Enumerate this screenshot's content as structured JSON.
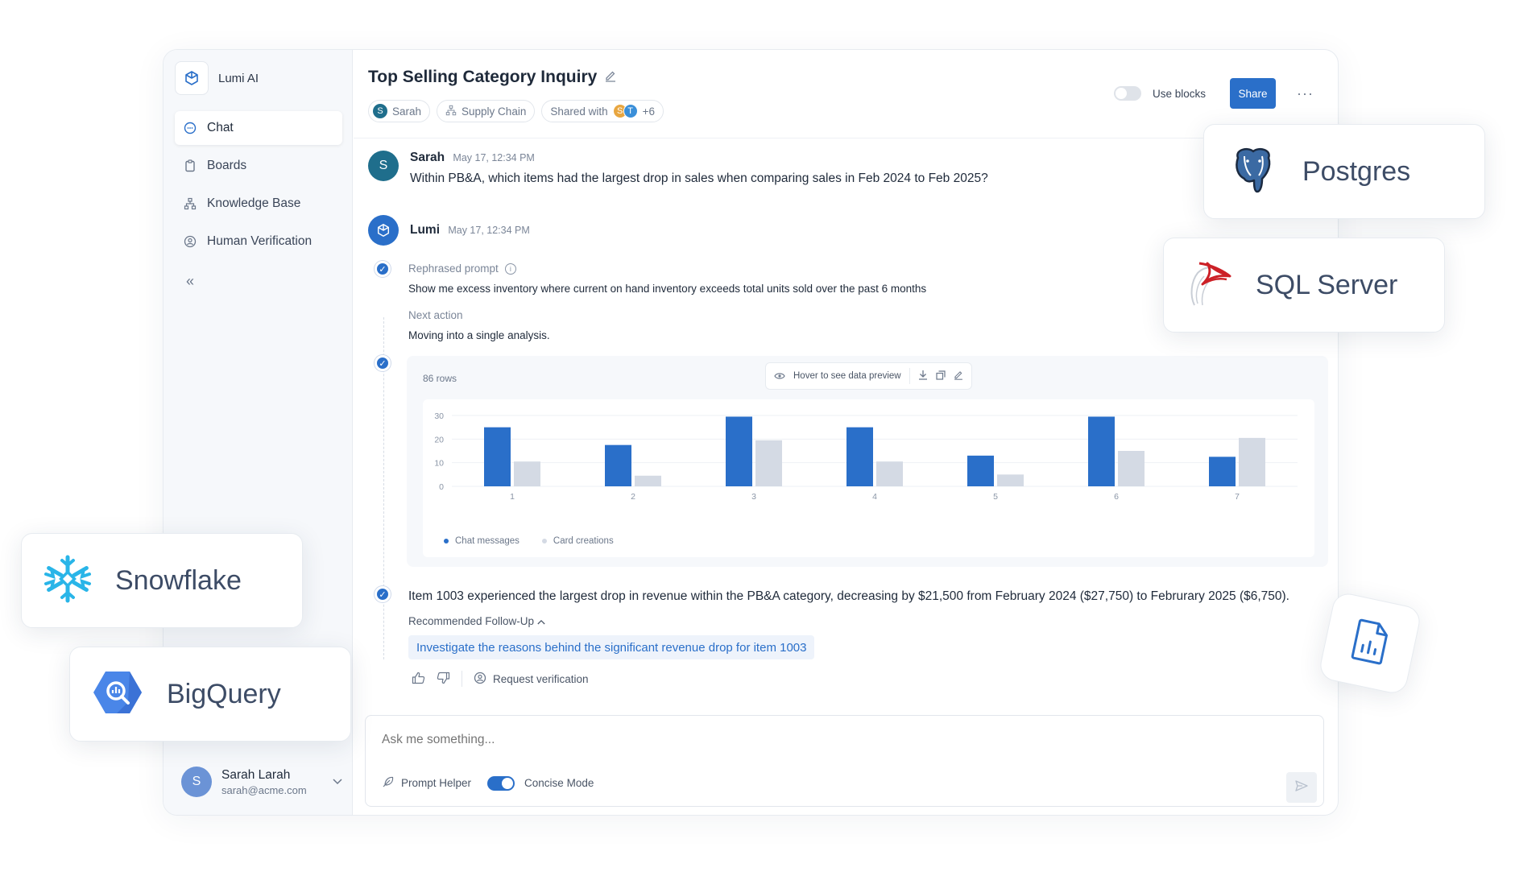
{
  "sidebar": {
    "brand": "Lumi AI",
    "items": [
      {
        "label": "Chat",
        "icon": "chat-icon",
        "active": true
      },
      {
        "label": "Boards",
        "icon": "clipboard-icon"
      },
      {
        "label": "Knowledge Base",
        "icon": "hierarchy-icon"
      },
      {
        "label": "Human Verification",
        "icon": "verification-icon"
      }
    ],
    "collapse_glyph": "«",
    "user": {
      "initial": "S",
      "name": "Sarah Larah",
      "email": "sarah@acme.com"
    }
  },
  "header": {
    "title": "Top Selling Category Inquiry",
    "chips": {
      "owner": {
        "initial": "S",
        "label": "Sarah"
      },
      "team": "Supply Chain",
      "shared": {
        "label": "Shared with",
        "initials": [
          "S",
          "T"
        ],
        "more": "+6"
      }
    },
    "use_blocks_label": "Use blocks",
    "share_label": "Share",
    "more_glyph": "···"
  },
  "messages": {
    "user": {
      "initial": "S",
      "name": "Sarah",
      "time": "May 17, 12:34 PM",
      "text": "Within PB&A, which items had the largest drop in sales when comparing sales in Feb 2024 to Feb 2025?"
    },
    "assistant": {
      "name": "Lumi",
      "time": "May 17, 12:34 PM"
    }
  },
  "steps": {
    "rephrased_label": "Rephrased prompt",
    "rephrased_text": "Show me excess inventory where current on hand inventory exceeds total units sold over the past 6 months",
    "next_label": "Next action",
    "next_text": "Moving into a single analysis."
  },
  "chart_toolbar": {
    "rows": "86 rows",
    "hover": "Hover to see data preview"
  },
  "chart_data": {
    "type": "bar",
    "categories": [
      "1",
      "2",
      "3",
      "4",
      "5",
      "6",
      "7"
    ],
    "series": [
      {
        "name": "Chat messages",
        "values": [
          25,
          17.5,
          29.5,
          25,
          13,
          29.5,
          12.5
        ],
        "color": "#2a6fc9"
      },
      {
        "name": "Card creations",
        "values": [
          10.5,
          4.5,
          19.5,
          10.5,
          5,
          15,
          20.5
        ],
        "color": "#d4dae4"
      }
    ],
    "yticks": [
      0,
      10,
      20,
      30
    ],
    "ylim": [
      0,
      30
    ]
  },
  "answer": {
    "text": "Item 1003 experienced the largest drop in revenue within the PB&A category, decreasing by $21,500 from February 2024 ($27,750) to Februrary 2025 ($6,750).",
    "followup_label": "Recommended Follow-Up",
    "followup_item": "Investigate the reasons behind the significant revenue drop for item 1003",
    "request_verification": "Request verification"
  },
  "input": {
    "placeholder": "Ask me something...",
    "prompt_helper": "Prompt Helper",
    "concise_mode": "Concise Mode"
  },
  "integrations": {
    "postgres": "Postgres",
    "sqlserver": "SQL Server",
    "snowflake": "Snowflake",
    "bigquery": "BigQuery"
  },
  "colors": {
    "accent": "#2a6fc9",
    "secondary": "#d4dae4",
    "teal_avatar": "#1f6e8c"
  }
}
